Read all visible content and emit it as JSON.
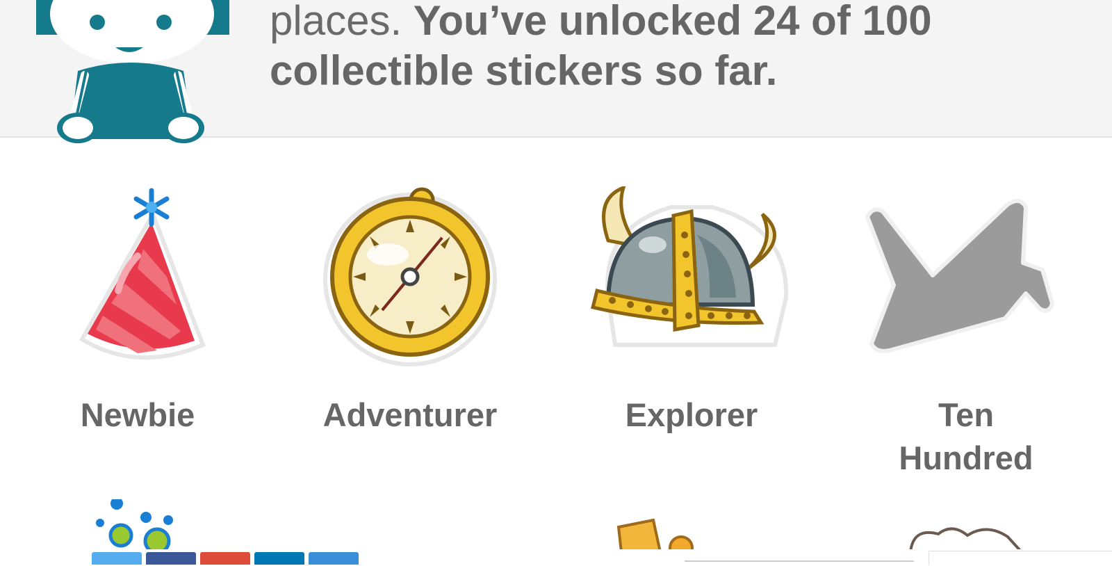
{
  "intro": {
    "lead": "places. ",
    "strong": "You’ve unlocked 24 of 100 collectible stickers so far."
  },
  "stickers": [
    {
      "name": "Newbie",
      "unlocked": true
    },
    {
      "name": "Adventurer",
      "unlocked": true
    },
    {
      "name": "Explorer",
      "unlocked": true
    },
    {
      "name": "Ten Hundred",
      "unlocked": false
    }
  ],
  "colors": {
    "mascot": "#157a8c",
    "banner_bg": "#f4f4f4",
    "text": "#666666",
    "locked": "#9b9b9b"
  },
  "share_buttons": [
    {
      "icon": "twitter-icon",
      "color": "#55acee"
    },
    {
      "icon": "facebook-icon",
      "color": "#3b5998"
    },
    {
      "icon": "googleplus-icon",
      "color": "#dd4b39"
    },
    {
      "icon": "linkedin-icon",
      "color": "#0077b5"
    },
    {
      "icon": "email-icon",
      "color": "#3a8fd8"
    }
  ]
}
